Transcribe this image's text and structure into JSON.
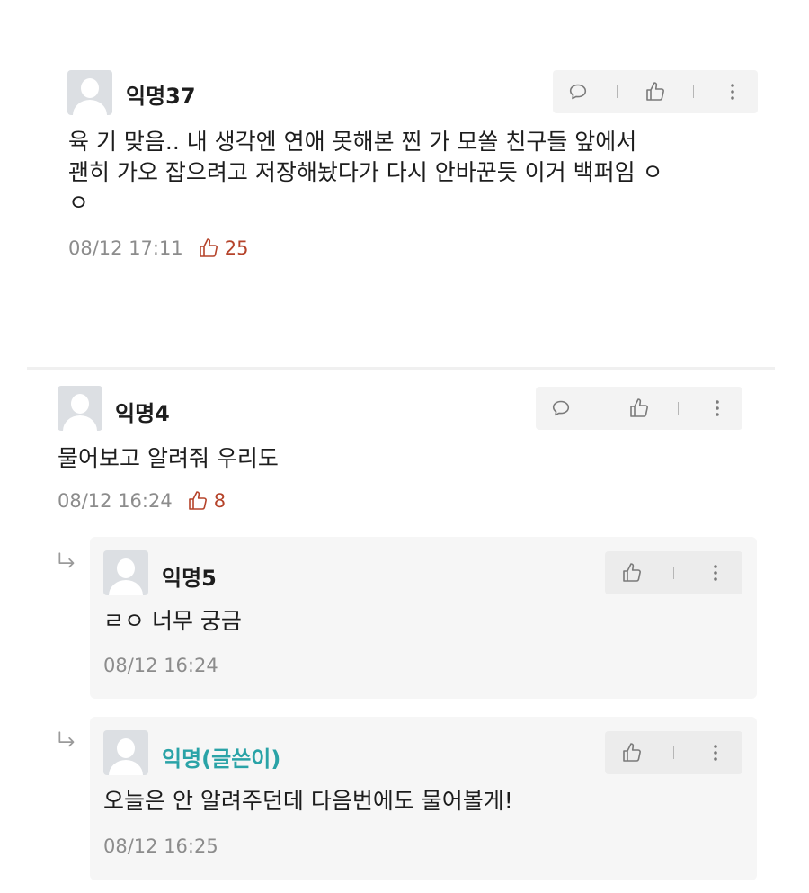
{
  "comments": [
    {
      "author": "익명37",
      "text_lines": [
        "육 기 맞음.. 내 생각엔 연애 못해본 찐  가 모쏠 친구들 앞에서",
        "괜히 가오 잡으려고 저장해놨다가 다시 안바꾼듯 이거 백퍼임 ㅇ",
        "ㅇ"
      ],
      "date": "08/12 17:11",
      "likes": "25"
    },
    {
      "author": "익명4",
      "text": "물어보고 알려줘 우리도",
      "date": "08/12 16:24",
      "likes": "8",
      "replies": [
        {
          "author": "익명5",
          "text": "ㄹㅇ 너무 궁금",
          "date": "08/12 16:24",
          "is_writer": false
        },
        {
          "author": "익명(글쓴이)",
          "text": "오늘은 안 알려주던데 다음번에도 물어볼게!",
          "date": "08/12 16:25",
          "is_writer": true
        }
      ]
    }
  ],
  "icons": {
    "comment": "speech-bubble-icon",
    "like": "thumbs-up-icon",
    "more": "more-vertical-icon",
    "reply": "reply-arrow-icon"
  },
  "colors": {
    "writer": "#2aa3a7",
    "likes": "#b5432a",
    "meta": "#8c8c8c"
  }
}
